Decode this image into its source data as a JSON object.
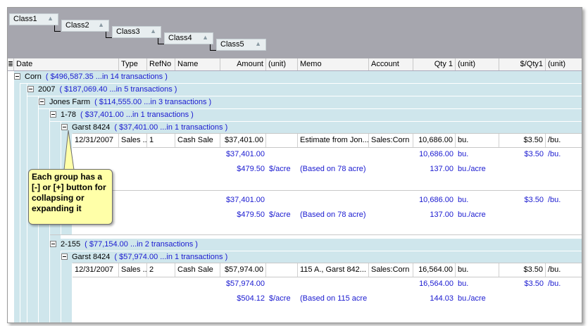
{
  "group_panel": {
    "chips": [
      {
        "label": "Class1"
      },
      {
        "label": "Class2"
      },
      {
        "label": "Class3"
      },
      {
        "label": "Class4"
      },
      {
        "label": "Class5"
      }
    ],
    "sort_glyph": "▲"
  },
  "columns": [
    {
      "label": "Date"
    },
    {
      "label": "Type"
    },
    {
      "label": "RefNo"
    },
    {
      "label": "Name"
    },
    {
      "label": "Amount"
    },
    {
      "label": "(unit)"
    },
    {
      "label": "Memo"
    },
    {
      "label": "Account"
    },
    {
      "label": "Qty 1"
    },
    {
      "label": "(unit)"
    },
    {
      "label": "$/Qty1"
    },
    {
      "label": "(unit)"
    }
  ],
  "groups": {
    "corn": {
      "label": "Corn",
      "summary": "( $496,587.35 ...in 14 transactions )"
    },
    "y2007": {
      "label": "2007",
      "summary": "( $187,069.40 ...in 5 transactions )"
    },
    "jones": {
      "label": "Jones Farm",
      "summary": "( $114,555.00 ...in 3 transactions )"
    },
    "g178": {
      "label": "1-78",
      "summary": "( $37,401.00 ...in 1 transactions )"
    },
    "garst1": {
      "label": "Garst 8424",
      "summary": "( $37,401.00 ...in 1 transactions )"
    },
    "g2155": {
      "label": "2-155",
      "summary": "( $77,154.00 ...in 2 transactions )"
    },
    "garst2": {
      "label": "Garst 8424",
      "summary": "( $57,974.00 ...in 1 transactions )"
    }
  },
  "rows": [
    {
      "date": "12/31/2007",
      "type": "Sales ...",
      "refno": "1",
      "name": "Cash Sale",
      "amount": "$37,401.00",
      "amount_unit": "",
      "memo": "Estimate from Jon...",
      "account": "Sales:Corn",
      "qty": "10,686.00",
      "qty_unit": "bu.",
      "per_qty": "$3.50",
      "per_unit": "/bu."
    },
    {
      "date": "12/31/2007",
      "type": "Sales ...",
      "refno": "2",
      "name": "Cash Sale",
      "amount": "$57,974.00",
      "amount_unit": "",
      "memo": "115 A., Garst 842...",
      "account": "Sales:Corn",
      "qty": "16,564.00",
      "qty_unit": "bu.",
      "per_qty": "$3.50",
      "per_unit": "/bu."
    }
  ],
  "summaries": {
    "s1": {
      "amount": "$37,401.00",
      "qty": "10,686.00",
      "qty_unit": "bu.",
      "per_qty": "$3.50",
      "per_unit": "/bu.",
      "acre_amount": "$479.50",
      "acre_unit": "$/acre",
      "acre_note": "(Based on 78 acre)",
      "acre_qty": "137.00",
      "acre_qty_unit": "bu./acre"
    },
    "s2": {
      "amount": "$37,401.00",
      "qty": "10,686.00",
      "qty_unit": "bu.",
      "per_qty": "$3.50",
      "per_unit": "/bu.",
      "acre_amount": "$479.50",
      "acre_unit": "$/acre",
      "acre_note": "(Based on 78 acre)",
      "acre_qty": "137.00",
      "acre_qty_unit": "bu./acre"
    },
    "s3": {
      "amount": "$57,974.00",
      "qty": "16,564.00",
      "qty_unit": "bu.",
      "per_qty": "$3.50",
      "per_unit": "/bu.",
      "acre_amount": "$504.12",
      "acre_unit": "$/acre",
      "acre_note": "(Based on 115 acre",
      "acre_qty": "144.03",
      "acre_qty_unit": "bu./acre"
    }
  },
  "callout": {
    "text": "Each group has a [-] or [+] button for collapsing or expanding it"
  }
}
